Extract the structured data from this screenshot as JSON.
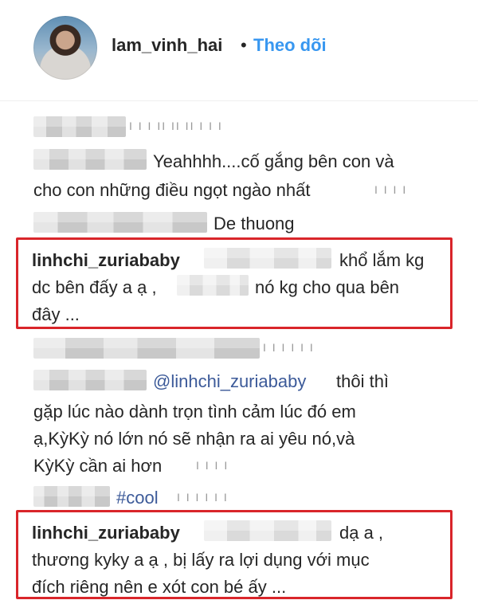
{
  "post_header": {
    "username": "lam_vinh_hai",
    "separator": "•",
    "follow_label": "Theo dõi"
  },
  "colors": {
    "follow_blue": "#3897f0",
    "mention_blue": "#3c5a99",
    "highlight_red": "#d9252a"
  },
  "comments": [
    {
      "meta": "I I I II II II I I I"
    },
    {
      "line1": "Yeahhhh....cố gắng bên con và",
      "line2": "cho con những điều ngọt ngào nhất",
      "meta": "I I I I"
    },
    {
      "text": "De thuong"
    },
    {
      "username": "linhchi_zuriababy",
      "line1_tail": "khổ lắm kg",
      "line2_a": "dc bên đấy a ạ ,",
      "line2_b": "nó kg cho qua bên",
      "line3": "đây ..."
    },
    {
      "meta": "I I I I I I"
    },
    {
      "mention": "@linhchi_zuriababy",
      "line1_tail": "thôi thì",
      "line2": "gặp lúc nào dành trọn tình cảm lúc đó em",
      "line3": "ạ,KỳKỳ nó lớn nó sẽ nhận ra ai yêu nó,và",
      "line4": "KỳKỳ cần ai hơn",
      "meta": "I I I I"
    },
    {
      "hashtag": "#cool",
      "meta": "I I I I I I"
    },
    {
      "username": "linhchi_zuriababy",
      "line1_tail": "dạ a ,",
      "line2": "thương kyky a ạ , bị lấy ra lợi dụng với mục",
      "line3": "đích riêng nên e xót con bé ấy ..."
    }
  ]
}
